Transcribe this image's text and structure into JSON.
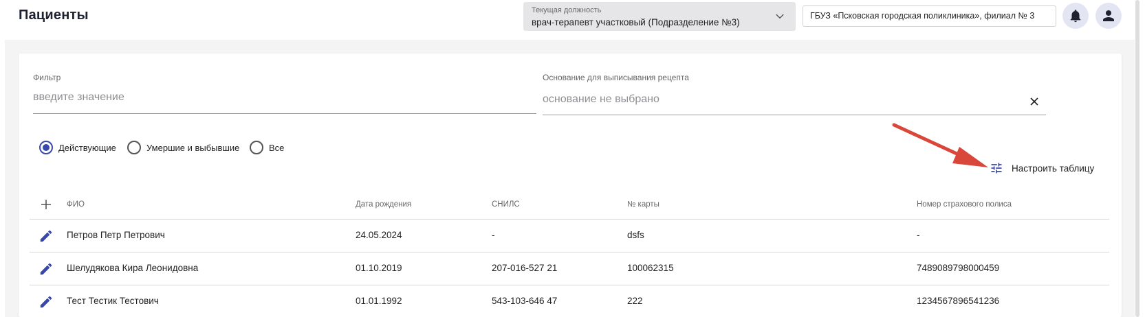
{
  "header": {
    "title": "Пациенты",
    "position": {
      "label": "Текущая должность",
      "value": "врач-терапевт участковый (Подразделение №3)"
    },
    "organization": "ГБУЗ «Псковская городская поликлиника», филиал № 3"
  },
  "filters": {
    "filter": {
      "label": "Фильтр",
      "placeholder": "введите значение"
    },
    "basis": {
      "label": "Основание для выписывания рецепта",
      "placeholder": "основание не выбрано"
    }
  },
  "status_options": {
    "active": "Действующие",
    "deceased": "Умершие и выбывшие",
    "all": "Все",
    "selected": "Действующие"
  },
  "configure_table": "Настроить таблицу",
  "table": {
    "headers": {
      "fio": "ФИО",
      "birth": "Дата рождения",
      "snils": "СНИЛС",
      "card": "№ карты",
      "policy": "Номер страхового полиса"
    },
    "rows": [
      {
        "fio": "Петров Петр Петрович",
        "birth": "24.05.2024",
        "snils": "-",
        "card": "dsfs",
        "policy": "-"
      },
      {
        "fio": "Шелудякова Кира Леонидовна",
        "birth": "01.10.2019",
        "snils": "207-016-527 21",
        "card": "100062315",
        "policy": "7489089798000459"
      },
      {
        "fio": "Тест Тестик Тестович",
        "birth": "01.01.1992",
        "snils": "543-103-646 47",
        "card": "222",
        "policy": "1234567896541236"
      }
    ]
  },
  "colors": {
    "accent": "#3949ab",
    "annotation_arrow": "#d9473b"
  },
  "icons": [
    "chevron-down-icon",
    "bell-icon",
    "user-icon",
    "close-icon",
    "tune-icon",
    "plus-icon",
    "pencil-icon"
  ]
}
